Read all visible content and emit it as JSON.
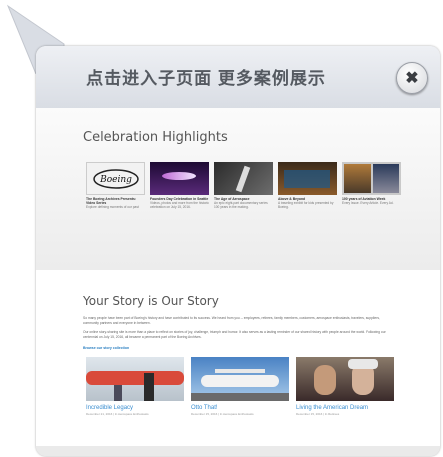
{
  "banner": {
    "text": "点击进入子页面 更多案例展示",
    "close_icon": "close-icon"
  },
  "highlights": {
    "title": "Celebration Highlights",
    "items": [
      {
        "title": "The Boeing Archives Presents: Video Series",
        "desc": "Explore defining moments of our past"
      },
      {
        "title": "Founders Day Celebration in Seattle",
        "desc": "Videos, photos and more from the historic celebration on July 15, 2016."
      },
      {
        "title": "The Age of Aerospace",
        "desc": "An epic eight-part documentary series 100 years in the making."
      },
      {
        "title": "Above & Beyond",
        "desc": "A traveling exhibit for kids presented by Boeing."
      },
      {
        "title": "100 years of Aviation Week",
        "desc": "Every Issue. Every Article. Every Ad."
      }
    ]
  },
  "story": {
    "title": "Your Story is Our Story",
    "p1": "So many people have been part of Boeing's history and have contributed to its success. We heard from you -- employees, retirees, family members, customers, aerospace enthusiasts, travelers, suppliers, community partners and everyone in between.",
    "p2": "Our online story-sharing site is more than a place to reflect on stories of joy, challenge, triumph and humor. It also serves as a lasting reminder of our shared history with people around the world. Following our centennial on July 15, 2016, all became a permanent part of the Boeing Archives.",
    "link": "Browse our story collection",
    "cards": [
      {
        "title": "Incredible Legacy",
        "meta": "December 21, 2016 | In Aerospace Enthusiasts"
      },
      {
        "title": "Otto That!",
        "meta": "December 15, 2016 | In Aerospace Enthusiasts"
      },
      {
        "title": "Living the American Dream",
        "meta": "December 15, 2016 | In Retirees"
      }
    ]
  }
}
